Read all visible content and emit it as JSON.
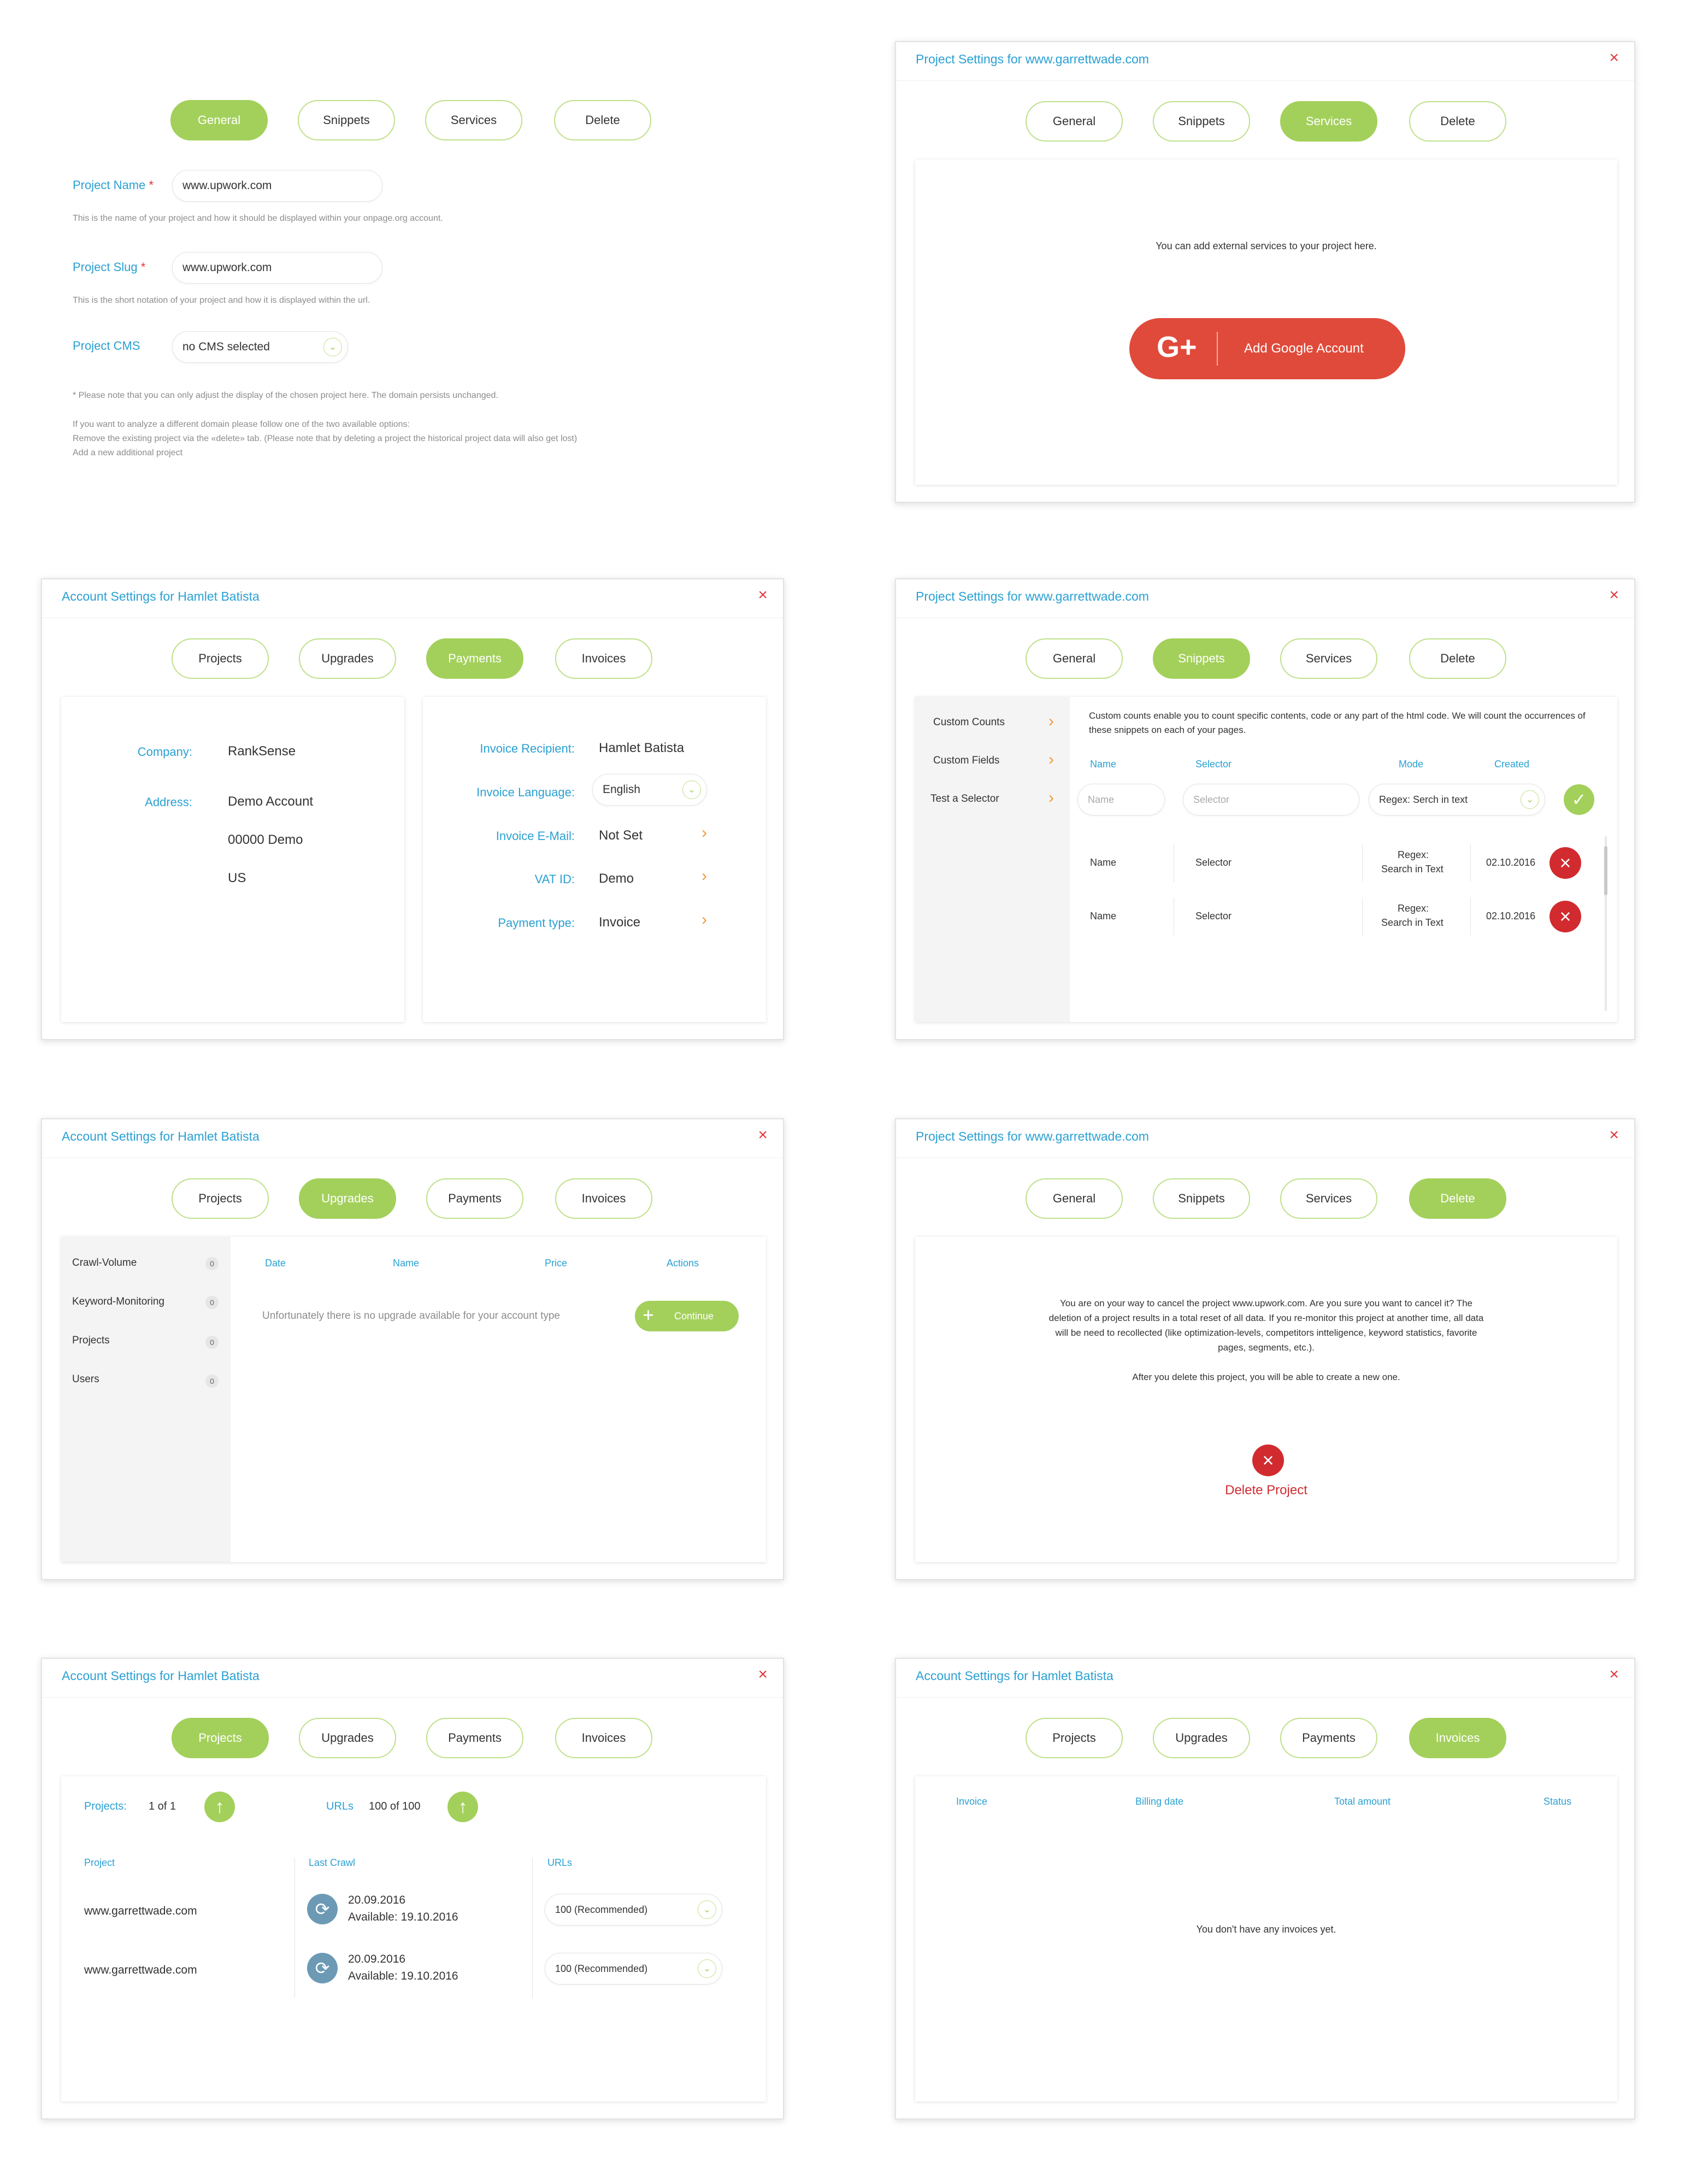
{
  "project_tabs": {
    "general": "General",
    "snippets": "Snippets",
    "services": "Services",
    "delete": "Delete"
  },
  "account_tabs": {
    "projects": "Projects",
    "upgrades": "Upgrades",
    "payments": "Payments",
    "invoices": "Invoices"
  },
  "close_glyph": "×",
  "chevron_glyph": "⌄",
  "arrow_glyph": "›",
  "colors": {
    "accent_green": "#a3d05b",
    "link_blue": "#2aa0d3",
    "danger_red": "#d12b2f",
    "google_red": "#e04a3a"
  },
  "general": {
    "name_label": "Project Name",
    "name_value": "www.upwork.com",
    "name_help": "This is the name of your project and how it should be displayed within your onpage.org account.",
    "slug_label": "Project Slug",
    "slug_value": "www.upwork.com",
    "slug_help": "This is the short notation of your project and how it is displayed within the url.",
    "required_mark": "*",
    "cms_label": "Project CMS",
    "cms_value": "no CMS selected",
    "note1": "* Please note that you can only adjust the display of the chosen project here. The domain persists unchanged.",
    "note2": "If you want to analyze a different domain please follow one of the two available options:",
    "note3": "Remove the existing project via the «delete» tab. (Please note that by deleting a project the historical project data will also get lost)",
    "note4": "Add a new additional project"
  },
  "services": {
    "title": "Project Settings for www.garrettwade.com",
    "text": "You can add external services to your project here.",
    "google_icon": "G+",
    "button": "Add Google Account"
  },
  "payments": {
    "title": "Account Settings for Hamlet Batista",
    "company_label": "Company:",
    "company_value": "RankSense",
    "address_label": "Address:",
    "address_line1": "Demo Account",
    "address_line2": "00000 Demo",
    "address_line3": "US",
    "recipient_label": "Invoice Recipient:",
    "recipient_value": "Hamlet Batista",
    "language_label": "Invoice Language:",
    "language_value": "English",
    "email_label": "Invoice E-Mail:",
    "email_value": "Not Set",
    "vat_label": "VAT ID:",
    "vat_value": "Demo",
    "ptype_label": "Payment type:",
    "ptype_value": "Invoice"
  },
  "snippets": {
    "title": "Project Settings for www.garrettwade.com",
    "side": [
      "Custom Counts",
      "Custom Fields",
      "Test a Selector"
    ],
    "intro": "Custom counts enable you to count specific contents, code or any part of the html code. We will count the occurrences of these snippets on each of your pages.",
    "cols": {
      "name": "Name",
      "selector": "Selector",
      "mode": "Mode",
      "created": "Created"
    },
    "name_placeholder": "Name",
    "selector_placeholder": "Selector",
    "mode_value": "Regex: Serch in text",
    "confirm_glyph": "✓",
    "rows": [
      {
        "name": "Name",
        "selector": "Selector",
        "mode1": "Regex:",
        "mode2": "Search in Text",
        "created": "02.10.2016"
      },
      {
        "name": "Name",
        "selector": "Selector",
        "mode1": "Regex:",
        "mode2": "Search in Text",
        "created": "02.10.2016"
      }
    ]
  },
  "upgrades": {
    "title": "Account Settings for Hamlet Batista",
    "side": [
      {
        "label": "Crawl-Volume",
        "count": "0"
      },
      {
        "label": "Keyword-Monitoring",
        "count": "0"
      },
      {
        "label": "Projects",
        "count": "0"
      },
      {
        "label": "Users",
        "count": "0"
      }
    ],
    "cols": {
      "date": "Date",
      "name": "Name",
      "price": "Price",
      "actions": "Actions"
    },
    "empty": "Unfortunately there is no upgrade available for your account type",
    "continue_plus": "+",
    "continue": "Continue"
  },
  "delete": {
    "title": "Project Settings for www.garrettwade.com",
    "line1": "You are on your way to cancel the project www.upwork.com. Are you sure you want to cancel it? The",
    "line2": "deletion of a project results in a total reset of all data. If you re-monitor this project at another time, all data",
    "line3": "will be need to recollected (like optimization-levels, competitors intteligence, keyword statistics, favorite",
    "line4": "pages, segments, etc.).",
    "line5": "After you delete this project, you will be able to create a new one.",
    "button": "Delete Project"
  },
  "projects": {
    "title": "Account Settings for Hamlet Batista",
    "projects_label": "Projects:",
    "projects_value": "1 of 1",
    "urls_label": "URLs",
    "urls_value": "100 of 100",
    "up_glyph": "↑",
    "sync_glyph": "⟳",
    "cols": {
      "project": "Project",
      "last_crawl": "Last Crawl",
      "urls": "URLs"
    },
    "rows": [
      {
        "project": "www.garrettwade.com",
        "date": "20.09.2016",
        "available": "Available: 19.10.2016",
        "urls": "100 (Recommended)"
      },
      {
        "project": "www.garrettwade.com",
        "date": "20.09.2016",
        "available": "Available: 19.10.2016",
        "urls": "100 (Recommended)"
      }
    ]
  },
  "invoices": {
    "title": "Account Settings for Hamlet Batista",
    "cols": {
      "invoice": "Invoice",
      "billing": "Billing date",
      "total": "Total amount",
      "status": "Status"
    },
    "empty": "You don't have any invoices yet."
  }
}
